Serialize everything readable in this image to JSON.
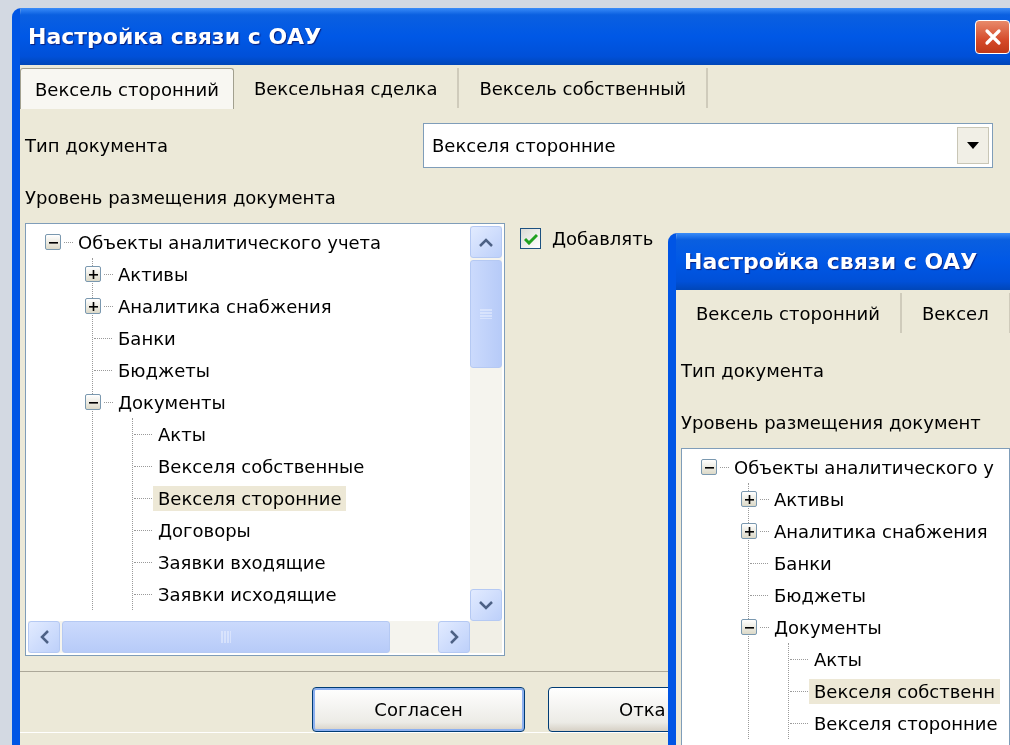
{
  "dialogs": [
    {
      "title": "Настройка связи с ОАУ",
      "tabs": [
        {
          "label": "Вексель сторонний",
          "selected": true
        },
        {
          "label": "Вексельная сделка",
          "selected": false
        },
        {
          "label": "Вексель собственный",
          "selected": false
        }
      ],
      "document_type_label": "Тип документа",
      "document_type_value": "Векселя сторонние",
      "level_label": "Уровень размещения документа",
      "tree": [
        {
          "label": "Объекты аналитического учета",
          "expanded": true,
          "selected": false,
          "children": [
            {
              "label": "Активы",
              "expanded": false,
              "selected": false
            },
            {
              "label": "Аналитика снабжения",
              "expanded": false,
              "selected": false
            },
            {
              "label": "Банки",
              "selected": false
            },
            {
              "label": "Бюджеты",
              "selected": false
            },
            {
              "label": "Документы",
              "expanded": true,
              "selected": false,
              "children": [
                {
                  "label": "Акты",
                  "selected": false
                },
                {
                  "label": "Векселя собственные",
                  "selected": false
                },
                {
                  "label": "Векселя сторонние",
                  "selected": true
                },
                {
                  "label": "Договоры",
                  "selected": false
                },
                {
                  "label": "Заявки входящие",
                  "selected": false
                },
                {
                  "label": "Заявки исходящие",
                  "selected": false
                }
              ]
            }
          ]
        }
      ],
      "checkbox": {
        "label": "Добавлять",
        "checked": true
      },
      "buttons": [
        {
          "label": "Согласен"
        },
        {
          "label": "Отка"
        }
      ]
    },
    {
      "title": "Настройка связи с ОАУ",
      "tabs": [
        {
          "label": "Вексель сторонний",
          "selected": false
        },
        {
          "label": "Вексел",
          "selected": false
        }
      ],
      "document_type_label": "Тип документа",
      "level_label": "Уровень размещения документ",
      "tree": [
        {
          "label": "Объекты аналитического у",
          "expanded": true,
          "selected": false,
          "children": [
            {
              "label": "Активы",
              "expanded": false,
              "selected": false
            },
            {
              "label": "Аналитика снабжения",
              "expanded": false,
              "selected": false
            },
            {
              "label": "Банки",
              "selected": false
            },
            {
              "label": "Бюджеты",
              "selected": false
            },
            {
              "label": "Документы",
              "expanded": true,
              "selected": false,
              "children": [
                {
                  "label": "Акты",
                  "selected": false
                },
                {
                  "label": "Векселя собственн",
                  "selected": true
                },
                {
                  "label": "Векселя сторонние",
                  "selected": false
                }
              ]
            }
          ]
        }
      ]
    }
  ]
}
